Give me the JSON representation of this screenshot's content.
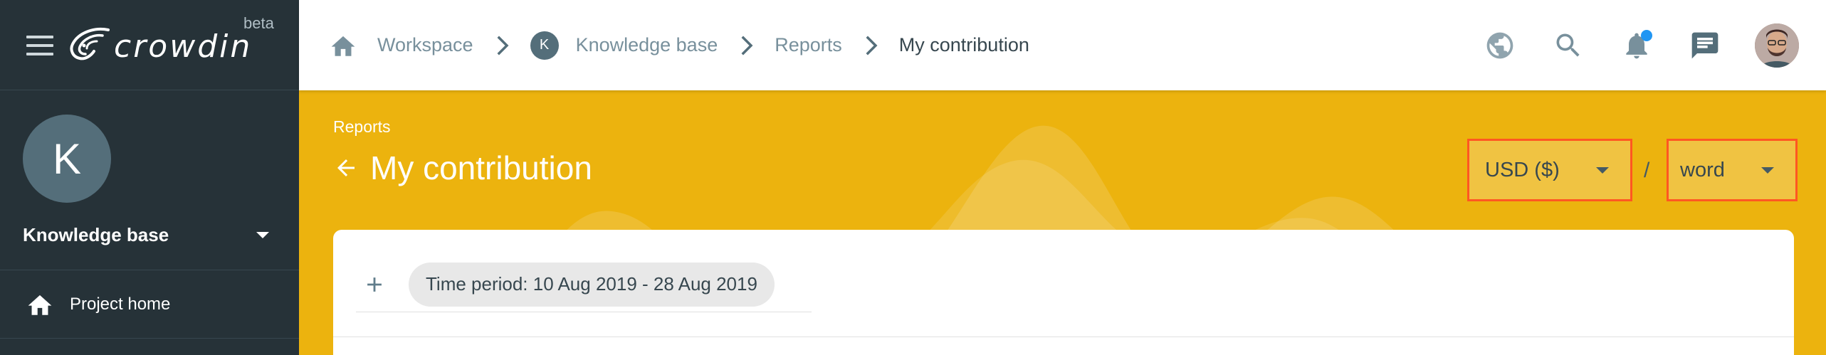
{
  "brand": {
    "name": "crowdin",
    "badge": "beta"
  },
  "project": {
    "initial": "K",
    "name": "Knowledge base"
  },
  "sidebar": {
    "items": [
      {
        "label": "Project home",
        "icon": "home-icon"
      }
    ]
  },
  "breadcrumb": {
    "items": [
      {
        "label": "Workspace"
      },
      {
        "label": "Knowledge base",
        "avatar": "K"
      },
      {
        "label": "Reports"
      },
      {
        "label": "My contribution"
      }
    ]
  },
  "topbar": {
    "icons": [
      "globe-icon",
      "search-icon",
      "bell-icon",
      "chat-icon"
    ],
    "has_notification": true
  },
  "page": {
    "parent_link": "Reports",
    "title": "My contribution",
    "currency": {
      "selected": "USD ($)"
    },
    "separator": "/",
    "unit": {
      "selected": "word"
    }
  },
  "filters": {
    "chips": [
      {
        "label": "Time period: 10 Aug 2019 - 28 Aug 2019"
      }
    ]
  },
  "colors": {
    "sidebar_bg": "#263238",
    "accent": "#ECB30E",
    "highlight_border": "#FF5722",
    "notification": "#2196F3"
  }
}
